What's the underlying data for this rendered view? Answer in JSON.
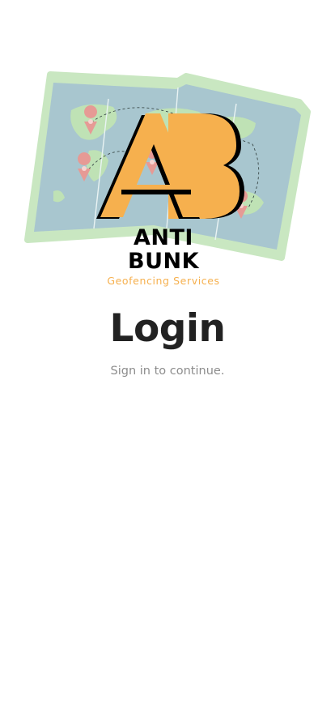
{
  "logo": {
    "monogram": "AB",
    "brand_line1": "ANTI",
    "brand_line2": "BUNK",
    "tagline": "Geofencing Services",
    "colors": {
      "map_border": "#c9e7c1",
      "map_water": "#a8c6cf",
      "land": "#bfe2b5",
      "pin": "#e69a95",
      "monogram_fill": "#f6b04e",
      "monogram_outline": "#000000",
      "tagline": "#f6b04e"
    }
  },
  "login": {
    "title": "Login",
    "subtitle": "Sign in to continue."
  }
}
